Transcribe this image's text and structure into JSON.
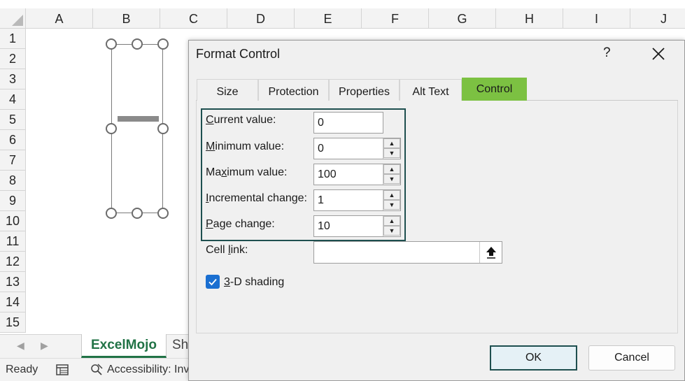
{
  "sheet": {
    "columns": [
      "A",
      "B",
      "C",
      "D",
      "E",
      "F",
      "G",
      "H",
      "I",
      "J"
    ],
    "rows": [
      "1",
      "2",
      "3",
      "4",
      "5",
      "6",
      "7",
      "8",
      "9",
      "10",
      "11",
      "12",
      "13",
      "14",
      "15"
    ],
    "tabs": {
      "active": "ExcelMojo",
      "next": "Sh"
    },
    "status": {
      "ready": "Ready",
      "accessibility": "Accessibility: Inve"
    }
  },
  "dialog": {
    "title": "Format Control",
    "help": "?",
    "tabs": [
      "Size",
      "Protection",
      "Properties",
      "Alt Text",
      "Control"
    ],
    "active_tab": "Control",
    "fields": {
      "current": {
        "label_u": "C",
        "label_rest": "urrent value:",
        "value": "0"
      },
      "minimum": {
        "label_u": "M",
        "label_rest": "inimum value:",
        "value": "0"
      },
      "maximum": {
        "label_pre": "Ma",
        "label_u": "x",
        "label_rest": "imum value:",
        "value": "100"
      },
      "incremental": {
        "label_u": "I",
        "label_rest": "ncremental change:",
        "value": "1"
      },
      "page": {
        "label_u": "P",
        "label_rest": "age change:",
        "value": "10"
      },
      "cell_link": {
        "label_pre": "Cell ",
        "label_u": "l",
        "label_rest": "ink:",
        "value": ""
      }
    },
    "shading": {
      "label_u": "3",
      "label_rest": "-D shading",
      "checked": true
    },
    "buttons": {
      "ok": "OK",
      "cancel": "Cancel"
    }
  },
  "colors": {
    "active_tab": "#7cc142",
    "highlight_border": "#1e4f4f",
    "excel_green": "#217346",
    "checkbox": "#1a6fd1"
  }
}
